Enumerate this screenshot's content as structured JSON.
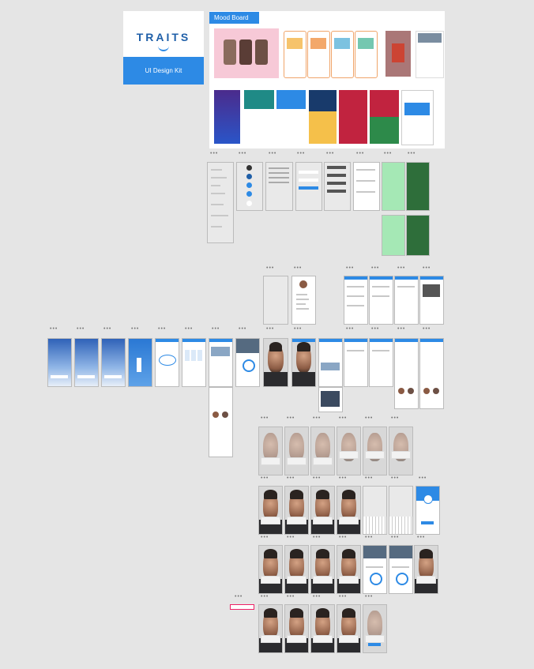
{
  "logo": {
    "brand": "TRAITS",
    "subtitle": "UI Design Kit"
  },
  "mood_board": {
    "title": "Mood Board"
  },
  "dots": "•••",
  "colors": {
    "canvas": "#e5e5e5",
    "accent": "#2d8ae5",
    "brand_text": "#1f5fa8",
    "green": "#a5e8b5"
  }
}
